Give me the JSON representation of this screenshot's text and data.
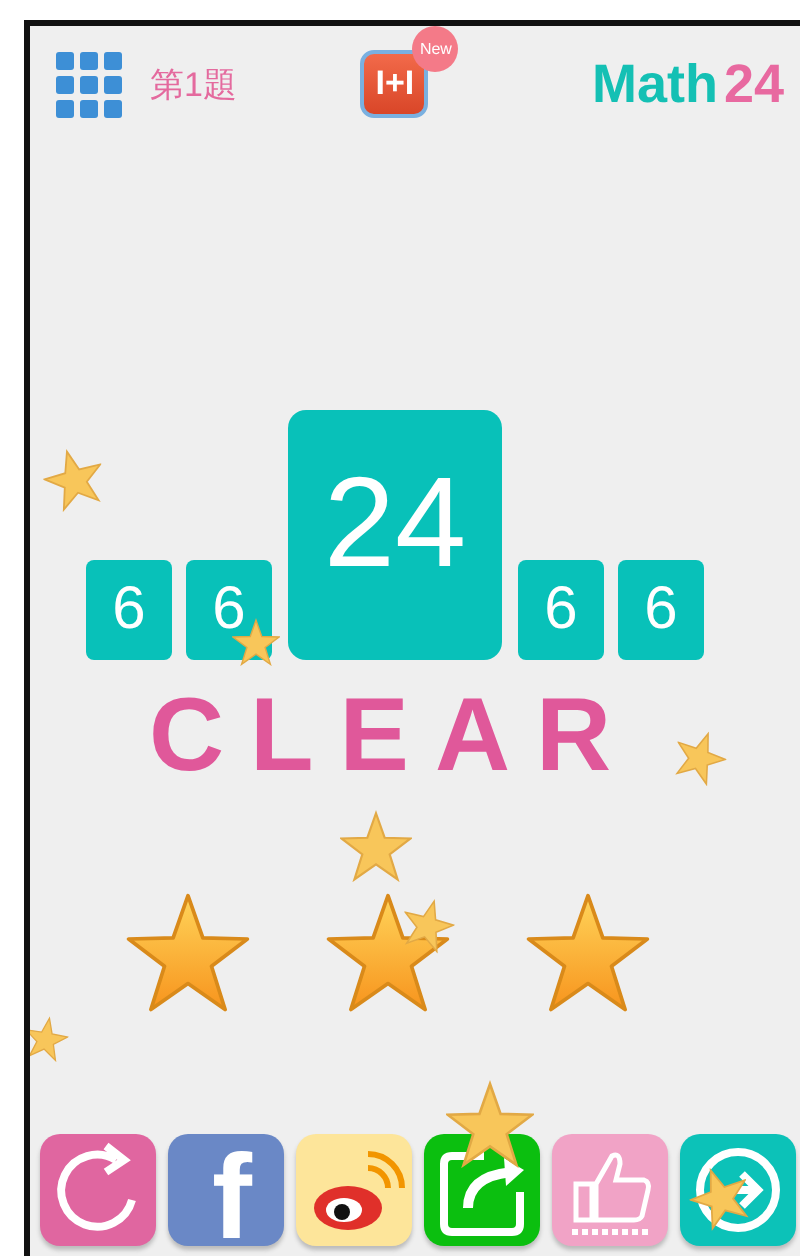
{
  "header": {
    "level_label": "第1題",
    "promo_app": {
      "label": "I+I",
      "badge": "New"
    },
    "title": {
      "word": "Math",
      "number": "24"
    }
  },
  "cards": [
    {
      "kind": "number",
      "value": "6"
    },
    {
      "kind": "number",
      "value": "6"
    },
    {
      "kind": "target",
      "value": "24"
    },
    {
      "kind": "number",
      "value": "6"
    },
    {
      "kind": "number",
      "value": "6"
    }
  ],
  "result": "CLEAR",
  "rating": {
    "stars": 3
  },
  "actions": [
    {
      "kind": "replay"
    },
    {
      "kind": "facebook",
      "label": "f"
    },
    {
      "kind": "weibo"
    },
    {
      "kind": "share"
    },
    {
      "kind": "like"
    },
    {
      "kind": "next"
    }
  ]
}
